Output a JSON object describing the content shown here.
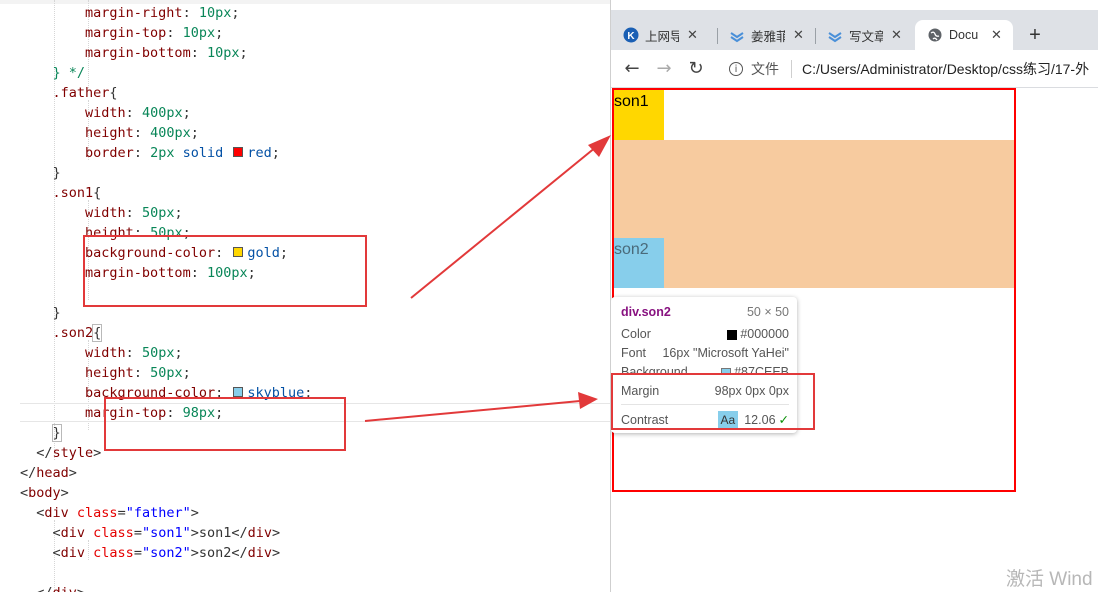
{
  "editor": {
    "lines": [
      {
        "segs": [
          {
            "t": "        ",
            "c": "d"
          },
          {
            "t": "margin-right",
            "c": "p"
          },
          {
            "t": ": ",
            "c": "d"
          },
          {
            "t": "10px",
            "c": "v"
          },
          {
            "t": ";",
            "c": "d"
          }
        ]
      },
      {
        "segs": [
          {
            "t": "        ",
            "c": "d"
          },
          {
            "t": "margin-top",
            "c": "p"
          },
          {
            "t": ": ",
            "c": "d"
          },
          {
            "t": "10px",
            "c": "v"
          },
          {
            "t": ";",
            "c": "d"
          }
        ]
      },
      {
        "segs": [
          {
            "t": "        ",
            "c": "d"
          },
          {
            "t": "margin-bottom",
            "c": "p"
          },
          {
            "t": ": ",
            "c": "d"
          },
          {
            "t": "10px",
            "c": "v"
          },
          {
            "t": ";",
            "c": "d"
          }
        ]
      },
      {
        "segs": [
          {
            "t": "    } */",
            "c": "v"
          }
        ]
      },
      {
        "segs": [
          {
            "t": "    ",
            "c": "d"
          },
          {
            "t": ".father",
            "c": "p"
          },
          {
            "t": "{",
            "c": "d"
          }
        ]
      },
      {
        "segs": [
          {
            "t": "        ",
            "c": "d"
          },
          {
            "t": "width",
            "c": "p"
          },
          {
            "t": ": ",
            "c": "d"
          },
          {
            "t": "400px",
            "c": "v"
          },
          {
            "t": ";",
            "c": "d"
          }
        ]
      },
      {
        "segs": [
          {
            "t": "        ",
            "c": "d"
          },
          {
            "t": "height",
            "c": "p"
          },
          {
            "t": ": ",
            "c": "d"
          },
          {
            "t": "400px",
            "c": "v"
          },
          {
            "t": ";",
            "c": "d"
          }
        ]
      },
      {
        "segs": [
          {
            "t": "        ",
            "c": "d"
          },
          {
            "t": "border",
            "c": "p"
          },
          {
            "t": ": ",
            "c": "d"
          },
          {
            "t": "2px",
            "c": "v"
          },
          {
            "t": " ",
            "c": "d"
          },
          {
            "t": "solid",
            "c": "k"
          },
          {
            "t": " ",
            "c": "d"
          },
          {
            "sw": "#ff0000"
          },
          {
            "t": "red",
            "c": "k"
          },
          {
            "t": ";",
            "c": "d"
          }
        ]
      },
      {
        "segs": [
          {
            "t": "    }",
            "c": "d"
          }
        ]
      },
      {
        "segs": [
          {
            "t": "    ",
            "c": "d"
          },
          {
            "t": ".son1",
            "c": "p"
          },
          {
            "t": "{",
            "c": "d"
          }
        ]
      },
      {
        "segs": [
          {
            "t": "        ",
            "c": "d"
          },
          {
            "t": "width",
            "c": "p"
          },
          {
            "t": ": ",
            "c": "d"
          },
          {
            "t": "50px",
            "c": "v"
          },
          {
            "t": ";",
            "c": "d"
          }
        ]
      },
      {
        "segs": [
          {
            "t": "        ",
            "c": "d"
          },
          {
            "t": "height",
            "c": "p"
          },
          {
            "t": ": ",
            "c": "d"
          },
          {
            "t": "50px",
            "c": "v"
          },
          {
            "t": ";",
            "c": "d"
          }
        ]
      },
      {
        "segs": [
          {
            "t": "        ",
            "c": "d"
          },
          {
            "t": "background-color",
            "c": "p"
          },
          {
            "t": ": ",
            "c": "d"
          },
          {
            "sw": "#ffd700"
          },
          {
            "t": "gold",
            "c": "k"
          },
          {
            "t": ";",
            "c": "d"
          }
        ]
      },
      {
        "segs": [
          {
            "t": "        ",
            "c": "d"
          },
          {
            "t": "margin-bottom",
            "c": "p"
          },
          {
            "t": ": ",
            "c": "d"
          },
          {
            "t": "100px",
            "c": "v"
          },
          {
            "t": ";",
            "c": "d"
          }
        ]
      },
      {
        "segs": []
      },
      {
        "segs": [
          {
            "t": "    }",
            "c": "d"
          }
        ]
      },
      {
        "segs": [
          {
            "t": "    ",
            "c": "d"
          },
          {
            "t": ".son2",
            "c": "p"
          },
          {
            "t": "{",
            "c": "d",
            "b": true
          }
        ]
      },
      {
        "segs": [
          {
            "t": "        ",
            "c": "d"
          },
          {
            "t": "width",
            "c": "p"
          },
          {
            "t": ": ",
            "c": "d"
          },
          {
            "t": "50px",
            "c": "v"
          },
          {
            "t": ";",
            "c": "d"
          }
        ]
      },
      {
        "segs": [
          {
            "t": "        ",
            "c": "d"
          },
          {
            "t": "height",
            "c": "p"
          },
          {
            "t": ": ",
            "c": "d"
          },
          {
            "t": "50px",
            "c": "v"
          },
          {
            "t": ";",
            "c": "d"
          }
        ]
      },
      {
        "segs": [
          {
            "t": "        ",
            "c": "d"
          },
          {
            "t": "background-color",
            "c": "p"
          },
          {
            "t": ": ",
            "c": "d"
          },
          {
            "sw": "#87ceeb"
          },
          {
            "t": "skyblue",
            "c": "k"
          },
          {
            "t": ";",
            "c": "d"
          }
        ]
      },
      {
        "segs": [
          {
            "t": "        ",
            "c": "d"
          },
          {
            "t": "margin-top",
            "c": "p"
          },
          {
            "t": ": ",
            "c": "d"
          },
          {
            "t": "98px",
            "c": "v"
          },
          {
            "t": ";",
            "c": "d"
          }
        ]
      },
      {
        "segs": [
          {
            "t": "    ",
            "c": "d"
          },
          {
            "t": "}",
            "c": "d",
            "b": true
          }
        ]
      },
      {
        "segs": [
          {
            "t": "  </",
            "c": "d"
          },
          {
            "t": "style",
            "c": "t"
          },
          {
            "t": ">",
            "c": "d"
          }
        ]
      },
      {
        "segs": [
          {
            "t": "</",
            "c": "d"
          },
          {
            "t": "head",
            "c": "t"
          },
          {
            "t": ">",
            "c": "d"
          }
        ]
      },
      {
        "segs": [
          {
            "t": "<",
            "c": "d"
          },
          {
            "t": "body",
            "c": "t"
          },
          {
            "t": ">",
            "c": "d"
          }
        ]
      },
      {
        "segs": [
          {
            "t": "  <",
            "c": "d"
          },
          {
            "t": "div",
            "c": "t"
          },
          {
            "t": " ",
            "c": "d"
          },
          {
            "t": "class",
            "c": "a"
          },
          {
            "t": "=",
            "c": "d"
          },
          {
            "t": "\"father\"",
            "c": "q"
          },
          {
            "t": ">",
            "c": "d"
          }
        ]
      },
      {
        "segs": [
          {
            "t": "    <",
            "c": "d"
          },
          {
            "t": "div",
            "c": "t"
          },
          {
            "t": " ",
            "c": "d"
          },
          {
            "t": "class",
            "c": "a"
          },
          {
            "t": "=",
            "c": "d"
          },
          {
            "t": "\"son1\"",
            "c": "q"
          },
          {
            "t": ">son1</",
            "c": "d"
          },
          {
            "t": "div",
            "c": "t"
          },
          {
            "t": ">",
            "c": "d"
          }
        ]
      },
      {
        "segs": [
          {
            "t": "    <",
            "c": "d"
          },
          {
            "t": "div",
            "c": "t"
          },
          {
            "t": " ",
            "c": "d"
          },
          {
            "t": "class",
            "c": "a"
          },
          {
            "t": "=",
            "c": "d"
          },
          {
            "t": "\"son2\"",
            "c": "q"
          },
          {
            "t": ">son2</",
            "c": "d"
          },
          {
            "t": "div",
            "c": "t"
          },
          {
            "t": ">",
            "c": "d"
          }
        ]
      },
      {
        "segs": []
      },
      {
        "segs": [
          {
            "t": "  </",
            "c": "d"
          },
          {
            "t": "div",
            "c": "t"
          },
          {
            "t": ">",
            "c": "d"
          }
        ]
      }
    ]
  },
  "browser": {
    "tabs": [
      {
        "label": "上网导",
        "icon": "k-logo-icon",
        "close": "✕"
      },
      {
        "label": "姜雅菲",
        "icon": "feather-icon",
        "close": "✕"
      },
      {
        "label": "写文章",
        "icon": "feather-icon",
        "close": "✕"
      },
      {
        "label": "Docu",
        "icon": "globe-icon",
        "close": "✕"
      }
    ],
    "new_tab": "+",
    "nav": {
      "back": "←",
      "forward": "→",
      "reload": "↻"
    },
    "address": {
      "security": "文件",
      "url": "C:/Users/Administrator/Desktop/css练习/17-外"
    }
  },
  "page": {
    "son1_text": "son1",
    "son2_text": "son2"
  },
  "tooltip": {
    "element": "div.son2",
    "size": "50 × 50",
    "color_label": "Color",
    "color_value": "#000000",
    "font_label": "Font",
    "font_value": "16px \"Microsoft YaHei\"",
    "background_label": "Background",
    "background_value": "#87CEEB",
    "margin_label": "Margin",
    "margin_value": "98px 0px 0px",
    "contrast_label": "Contrast",
    "contrast_badge": "Aa",
    "contrast_value": "12.06",
    "contrast_check": "✓"
  },
  "colors": {
    "annotation_red": "#e2393a",
    "gold": "#ffd700",
    "skyblue": "#87ceeb",
    "margin_highlight": "#f7cb9f",
    "father_border": "#ff0000"
  },
  "watermark": "激活 Wind"
}
